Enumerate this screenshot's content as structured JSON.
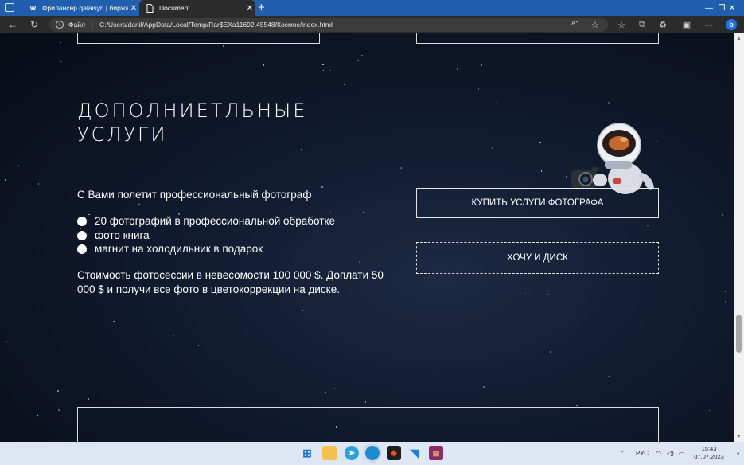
{
  "browser": {
    "tabs": [
      {
        "label": "Фрилансер qalaisyn | биржа фр",
        "icon": "W"
      },
      {
        "label": "Document"
      }
    ],
    "address_label": "Файл",
    "url": "C:/Users/danil/AppData/Local/Temp/Rar$EXa11692.45548/Космос/index.html"
  },
  "page": {
    "section_title": "ДОПОЛНИЕТЛЬНЫЕ УСЛУГИ",
    "lead": "С Вами полетит профессиональный фотограф",
    "features": [
      "20 фотографий в профессиональной обработке",
      "фото книга",
      "магнит на холодильник в подарок"
    ],
    "price_text": "Стоимость фотосессии в невесомости 100 000 $. Доплати 50 000 $ и получи все фото в цветокоррекции на диске.",
    "buy_button": "КУПИТЬ УСЛУГИ ФОТОГРАФА",
    "disk_button": "ХОЧУ И ДИСК"
  },
  "taskbar": {
    "language": "РУС",
    "time": "15:43",
    "date": "07.07.2023"
  }
}
